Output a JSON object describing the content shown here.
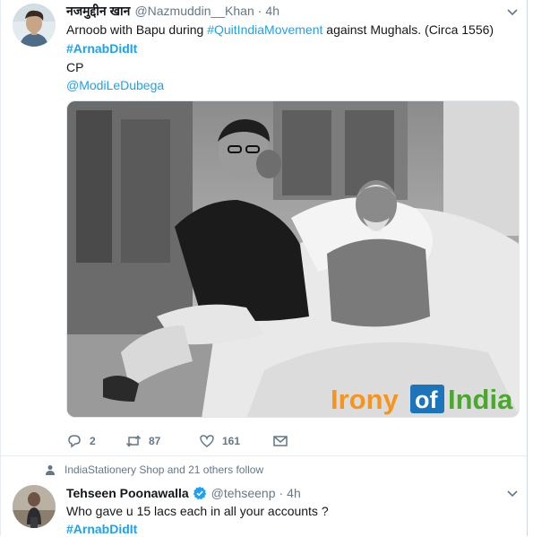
{
  "tweet1": {
    "display_name": "नजमुद्दीन खान",
    "handle": "@Nazmuddin__Khan",
    "separator": "·",
    "time": "4h",
    "line1": {
      "prefix": "Arnoob with Bapu during ",
      "hashtag": "#QuitIndiaMovement",
      "suffix": " against Mughals. (Circa 1556)"
    },
    "line2_hashtag": "#ArnabDidIt",
    "line3": "CP",
    "line4_mention": "@ModiLeDubega",
    "photo": {
      "watermark_word1": "Irony",
      "watermark_word2": "of",
      "watermark_word3": "India"
    },
    "actions": {
      "replies": "2",
      "retweets": "87",
      "likes": "161"
    }
  },
  "social_context": "IndiaStationery Shop and 21 others follow",
  "tweet2": {
    "display_name": "Tehseen Poonawalla",
    "handle": "@tehseenp",
    "separator": "·",
    "time": "4h",
    "line1": "Who gave u 15 lacs each in all your accounts ?",
    "line2_hashtag": "#ArnabDidIt"
  },
  "colors": {
    "accent": "#1da1f2",
    "muted": "#657786",
    "watermark_orange": "#f7941d",
    "watermark_blue": "#1c75bc"
  }
}
